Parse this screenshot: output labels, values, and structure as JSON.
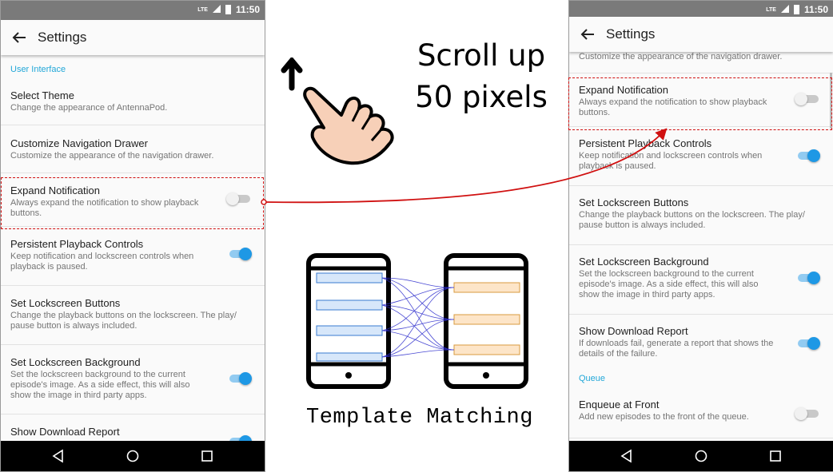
{
  "screen_left": {
    "status": {
      "network": "LTE",
      "time": "11:50"
    },
    "appbar": {
      "title": "Settings"
    },
    "items": [
      {
        "kind": "category",
        "label": "User Interface"
      },
      {
        "kind": "pref",
        "title": "Select Theme",
        "summary": "Change the appearance of AntennaPod."
      },
      {
        "kind": "pref",
        "title": "Customize Navigation Drawer",
        "summary": "Customize the appearance of the navigation drawer."
      },
      {
        "kind": "pref",
        "title": "Expand Notification",
        "summary": "Always expand the notification to show playback buttons.",
        "switch": "off"
      },
      {
        "kind": "pref",
        "title": "Persistent Playback Controls",
        "summary": "Keep notification and lockscreen controls when playback is paused.",
        "switch": "on"
      },
      {
        "kind": "pref",
        "title": "Set Lockscreen Buttons",
        "summary": "Change the playback buttons on the lockscreen. The play/ pause button is always included."
      },
      {
        "kind": "pref",
        "title": "Set Lockscreen Background",
        "summary": "Set the lockscreen background to the current episode's image. As a side effect, this will also show the image in third party apps.",
        "switch": "on"
      },
      {
        "kind": "pref",
        "title": "Show Download Report",
        "summary": "",
        "switch": "on"
      }
    ]
  },
  "screen_right": {
    "status": {
      "network": "LTE",
      "time": "11:50"
    },
    "appbar": {
      "title": "Settings"
    },
    "items": [
      {
        "kind": "pref",
        "title": "",
        "summary": "Customize the appearance of the navigation drawer."
      },
      {
        "kind": "pref",
        "title": "Expand Notification",
        "summary": "Always expand the notification to show playback buttons.",
        "switch": "off"
      },
      {
        "kind": "pref",
        "title": "Persistent Playback Controls",
        "summary": "Keep notification and lockscreen controls when playback is paused.",
        "switch": "on"
      },
      {
        "kind": "pref",
        "title": "Set Lockscreen Buttons",
        "summary": "Change the playback buttons on the lockscreen. The play/ pause button is always included."
      },
      {
        "kind": "pref",
        "title": "Set Lockscreen Background",
        "summary": "Set the lockscreen background to the current episode's image. As a side effect, this will also show the image in third party apps.",
        "switch": "on"
      },
      {
        "kind": "pref",
        "title": "Show Download Report",
        "summary": "If downloads fail, generate a report that shows the details of the failure.",
        "switch": "on"
      },
      {
        "kind": "category",
        "label": "Queue"
      },
      {
        "kind": "pref",
        "title": "Enqueue at Front",
        "summary": "Add new episodes to the front of the queue.",
        "switch": "off"
      }
    ]
  },
  "annotation": {
    "scroll_instruction": "Scroll up 50 pixels",
    "method_label": "Template Matching",
    "icons": [
      "pointing-hand-icon",
      "up-arrow-icon",
      "phone-template-icon",
      "phone-target-icon"
    ],
    "colors": {
      "accent": "#22a7d8",
      "switch_on": "#1e98e5",
      "highlight": "#d01010",
      "match_lines": "#2a2acc"
    }
  }
}
